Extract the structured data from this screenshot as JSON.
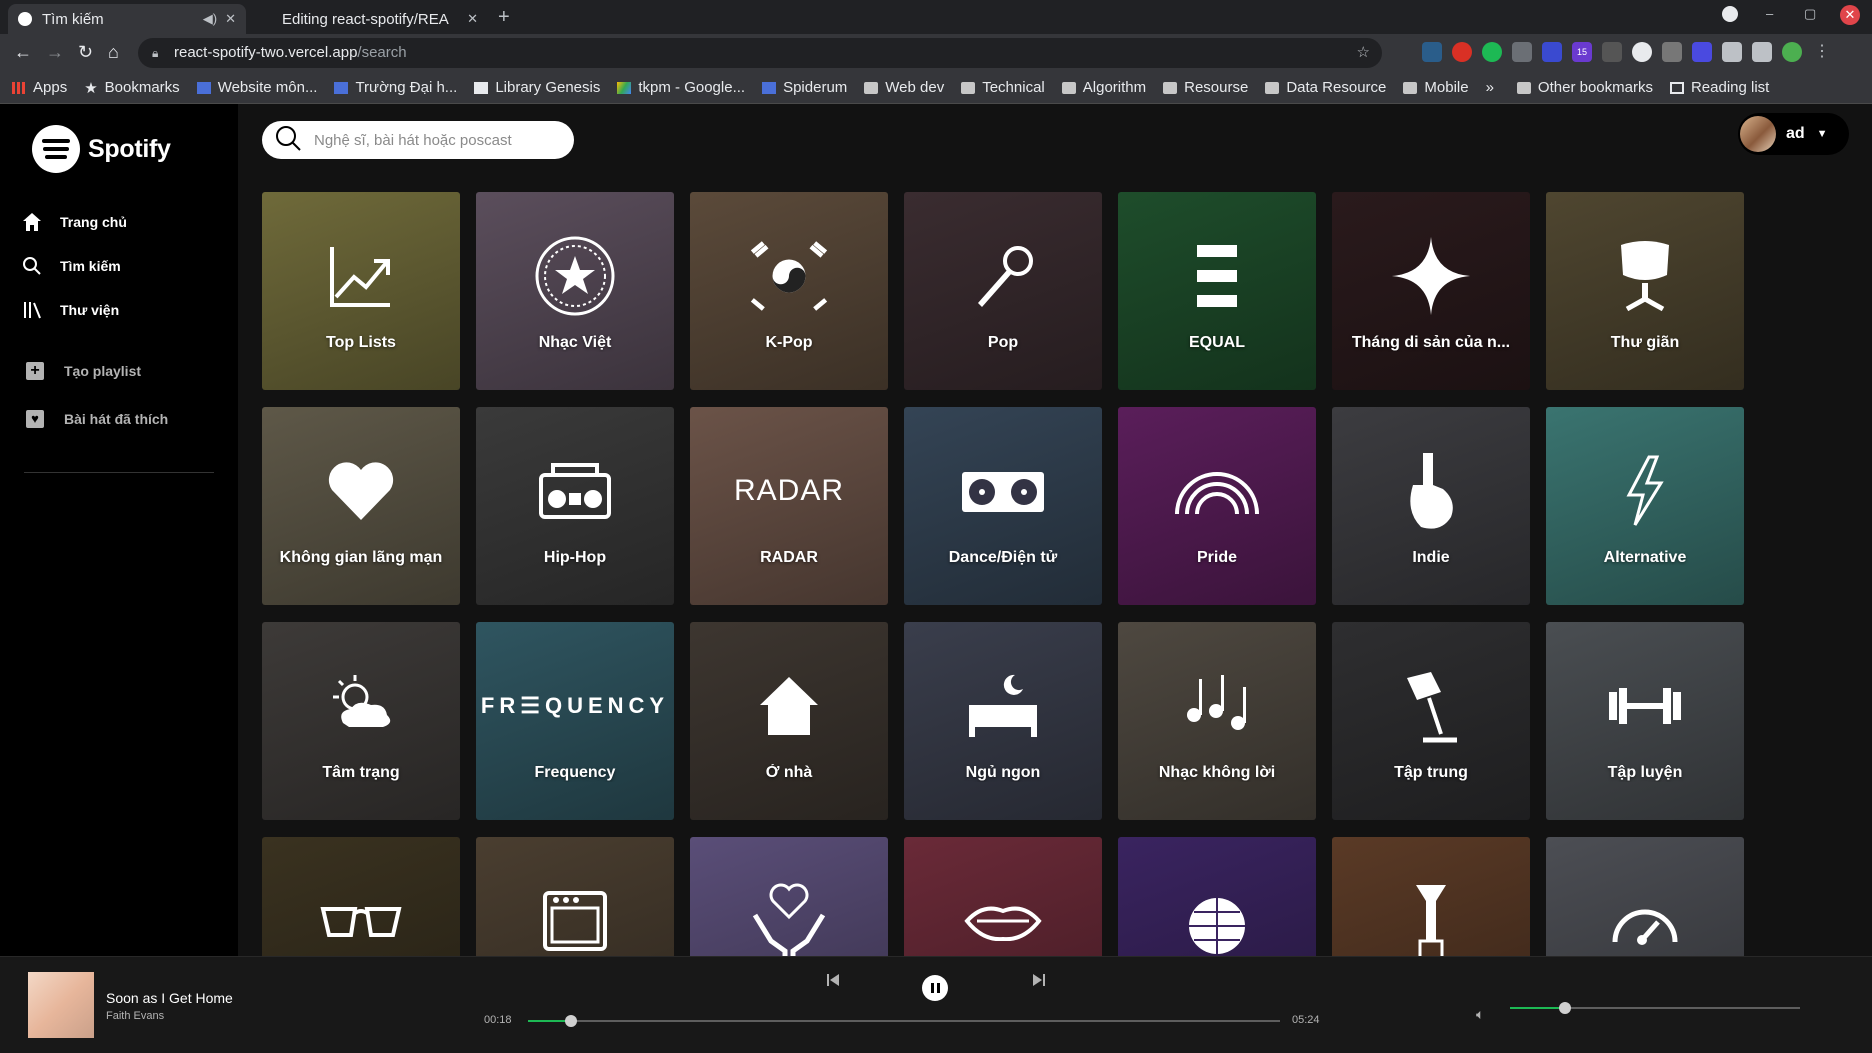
{
  "browser": {
    "tabs": [
      {
        "title": "Tìm kiếm",
        "active": true
      },
      {
        "title": "Editing react-spotify/REA",
        "active": false
      }
    ],
    "url_domain": "react-spotify-two.vercel.app",
    "url_path": "/search",
    "bookmarks": [
      {
        "label": "Apps",
        "icon": "apps-grid-icon"
      },
      {
        "label": "Bookmarks",
        "icon": "star-icon"
      },
      {
        "label": "Website môn...",
        "icon": "site-icon"
      },
      {
        "label": "Trường Đại h...",
        "icon": "site-icon"
      },
      {
        "label": "Library Genesis",
        "icon": "book-icon"
      },
      {
        "label": "tkpm - Google...",
        "icon": "drive-icon"
      },
      {
        "label": "Spiderum",
        "icon": "site-icon"
      },
      {
        "label": "Web dev",
        "icon": "folder-icon"
      },
      {
        "label": "Technical",
        "icon": "folder-icon"
      },
      {
        "label": "Algorithm",
        "icon": "folder-icon"
      },
      {
        "label": "Resourse",
        "icon": "folder-icon"
      },
      {
        "label": "Data Resource",
        "icon": "folder-icon"
      },
      {
        "label": "Mobile",
        "icon": "folder-icon"
      },
      {
        "label": "»",
        "icon": ""
      },
      {
        "label": "Other bookmarks",
        "icon": "folder-icon"
      },
      {
        "label": "Reading list",
        "icon": "reading-list-icon"
      }
    ],
    "extension_badge": "15"
  },
  "sidebar": {
    "logo": "Spotify",
    "nav": [
      {
        "label": "Trang chủ",
        "icon": "home-icon"
      },
      {
        "label": "Tìm kiếm",
        "icon": "search-icon"
      },
      {
        "label": "Thư viện",
        "icon": "library-icon"
      }
    ],
    "actions": [
      {
        "label": "Tạo playlist",
        "icon": "plus-icon"
      },
      {
        "label": "Bài hát đã thích",
        "icon": "heart-icon"
      }
    ]
  },
  "search": {
    "placeholder": "Nghệ sĩ, bài hát hoặc poscast"
  },
  "user": {
    "name": "ad"
  },
  "categories": [
    {
      "label": "Top Lists",
      "icon": "chart-icon",
      "color": "#6f6a3a"
    },
    {
      "label": "Nhạc Việt",
      "icon": "vietnam-emblem-icon",
      "color": "#5b4e5c"
    },
    {
      "label": "K-Pop",
      "icon": "korea-flag-icon",
      "color": "#5b4a3a"
    },
    {
      "label": "Pop",
      "icon": "microphone-icon",
      "color": "#3a2c30"
    },
    {
      "label": "EQUAL",
      "icon": "equal-icon",
      "color": "#1e4d2b"
    },
    {
      "label": "Tháng di sản của n...",
      "icon": "sparkle-icon",
      "color": "#2a1a1c"
    },
    {
      "label": "Thư giãn",
      "icon": "chair-icon",
      "color": "#4f4630"
    },
    {
      "label": "Không gian lãng mạn",
      "icon": "heart-icon",
      "color": "#5e5848"
    },
    {
      "label": "Hip-Hop",
      "icon": "boombox-icon",
      "color": "#3a3a3a"
    },
    {
      "label": "RADAR",
      "icon": "radar-text-icon",
      "color": "#6b5348"
    },
    {
      "label": "Dance/Điện tử",
      "icon": "turntable-icon",
      "color": "#344455"
    },
    {
      "label": "Pride",
      "icon": "rainbow-icon",
      "color": "#5a1e5a"
    },
    {
      "label": "Indie",
      "icon": "guitar-icon",
      "color": "#3c3c40"
    },
    {
      "label": "Alternative",
      "icon": "lightning-icon",
      "color": "#3a7470"
    },
    {
      "label": "Tâm trạng",
      "icon": "weather-icon",
      "color": "#3d3a38"
    },
    {
      "label": "Frequency",
      "icon": "frequency-text-icon",
      "color": "#2f5560"
    },
    {
      "label": "Ở nhà",
      "icon": "house-icon",
      "color": "#3d3630"
    },
    {
      "label": "Ngủ ngon",
      "icon": "bed-icon",
      "color": "#3a3e4c"
    },
    {
      "label": "Nhạc không lời",
      "icon": "music-notes-icon",
      "color": "#4e4840"
    },
    {
      "label": "Tập trung",
      "icon": "lamp-icon",
      "color": "#2e2e30"
    },
    {
      "label": "Tập luyện",
      "icon": "dumbbell-icon",
      "color": "#4a4e52"
    },
    {
      "label": "",
      "icon": "sunglasses-icon",
      "color": "#3a3220"
    },
    {
      "label": "",
      "icon": "amplifier-icon",
      "color": "#4a3e30"
    },
    {
      "label": "",
      "icon": "heart-hands-icon",
      "color": "#5a4e78"
    },
    {
      "label": "",
      "icon": "lips-icon",
      "color": "#6a2a38"
    },
    {
      "label": "",
      "icon": "disco-ball-icon",
      "color": "#3a2460"
    },
    {
      "label": "",
      "icon": "trumpet-icon",
      "color": "#5a3a26"
    },
    {
      "label": "",
      "icon": "gauge-icon",
      "color": "#4c4e54"
    }
  ],
  "player": {
    "title": "Soon as I Get Home",
    "artist": "Faith Evans",
    "elapsed": "00:18",
    "duration": "05:24",
    "progress_fraction": 0.057,
    "volume_fraction": 0.19,
    "accent": "#1db954"
  }
}
